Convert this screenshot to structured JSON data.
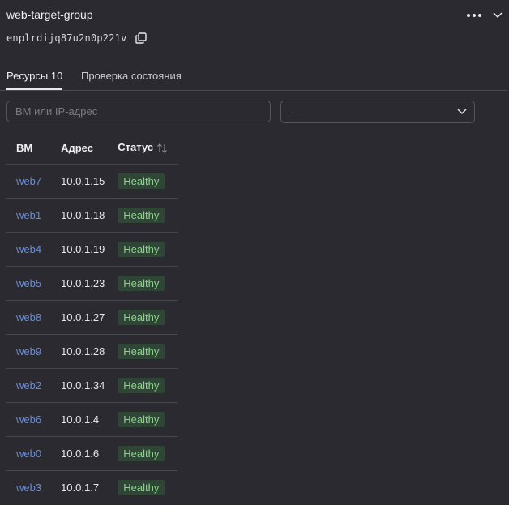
{
  "header": {
    "title": "web-target-group",
    "id": "enplrdijq87u2n0p221v"
  },
  "icons": {
    "more": "more-horizontal-icon",
    "expand": "chevron-down-icon",
    "copy": "copy-icon",
    "sort": "sort-icon"
  },
  "tabs": [
    {
      "label": "Ресурсы 10",
      "active": true
    },
    {
      "label": "Проверка состояния",
      "active": false
    }
  ],
  "filters": {
    "search_placeholder": "ВМ или IP-адрес",
    "select_value": "—"
  },
  "table": {
    "columns": [
      "ВМ",
      "Адрес",
      "Статус"
    ],
    "rows": [
      {
        "vm": "web7",
        "address": "10.0.1.15",
        "status": "Healthy"
      },
      {
        "vm": "web1",
        "address": "10.0.1.18",
        "status": "Healthy"
      },
      {
        "vm": "web4",
        "address": "10.0.1.19",
        "status": "Healthy"
      },
      {
        "vm": "web5",
        "address": "10.0.1.23",
        "status": "Healthy"
      },
      {
        "vm": "web8",
        "address": "10.0.1.27",
        "status": "Healthy"
      },
      {
        "vm": "web9",
        "address": "10.0.1.28",
        "status": "Healthy"
      },
      {
        "vm": "web2",
        "address": "10.0.1.34",
        "status": "Healthy"
      },
      {
        "vm": "web6",
        "address": "10.0.1.4",
        "status": "Healthy"
      },
      {
        "vm": "web0",
        "address": "10.0.1.6",
        "status": "Healthy"
      },
      {
        "vm": "web3",
        "address": "10.0.1.7",
        "status": "Healthy"
      }
    ]
  },
  "colors": {
    "background": "#2b2a30",
    "link": "#5f8ee8",
    "healthy_text": "#8fd18f",
    "healthy_bg": "#2f4535"
  }
}
